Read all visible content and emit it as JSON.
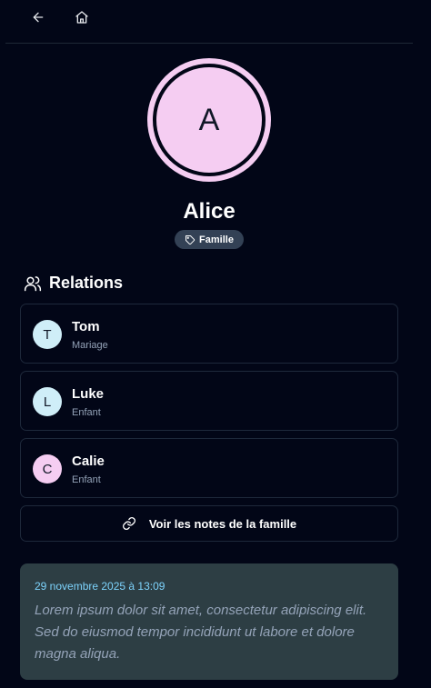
{
  "nav": {
    "back_icon": "arrow-left-icon",
    "home_icon": "home-icon"
  },
  "profile": {
    "initial": "A",
    "name": "Alice",
    "avatar_color": "#f5cdf2",
    "tag_label": "Famille"
  },
  "relations": {
    "title": "Relations",
    "items": [
      {
        "initial": "T",
        "name": "Tom",
        "type": "Mariage",
        "color": "#cfeef8"
      },
      {
        "initial": "L",
        "name": "Luke",
        "type": "Enfant",
        "color": "#cfeef8"
      },
      {
        "initial": "C",
        "name": "Calie",
        "type": "Enfant",
        "color": "#f5cdf2"
      }
    ]
  },
  "family_notes_button": "Voir les notes de la famille",
  "note": {
    "date": "29 novembre 2025 à 13:09",
    "text": "Lorem ipsum dolor sit amet, consectetur adipiscing elit. Sed do eiusmod tempor incididunt ut labore et dolore magna aliqua."
  },
  "colors": {
    "background": "#020617",
    "card_border": "#1e293b",
    "tag_bg": "#334155",
    "note_bg": "#2d3e44",
    "note_date": "#7dd3fc"
  }
}
